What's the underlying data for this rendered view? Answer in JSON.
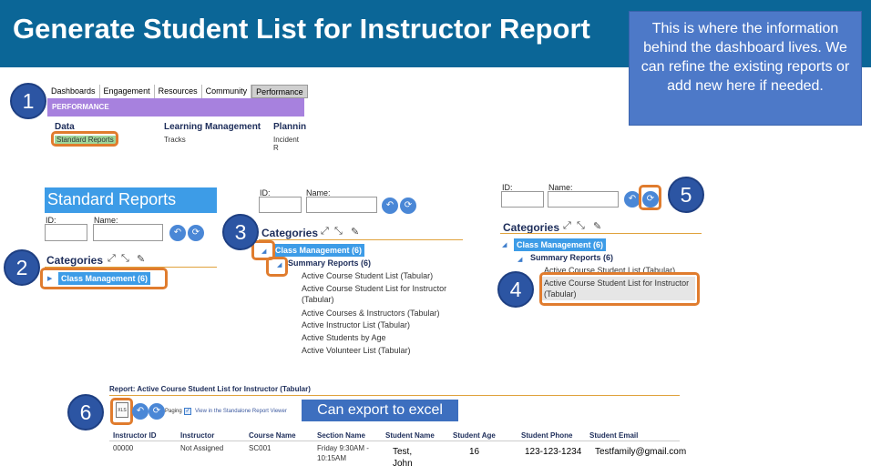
{
  "header": {
    "title": "Generate Student List for Instructor Report",
    "note": "This is where the information behind the dashboard lives. We can refine the existing reports or add new here if needed."
  },
  "steps": [
    "1",
    "2",
    "3",
    "4",
    "5",
    "6"
  ],
  "panel1": {
    "tabs": [
      "Dashboards",
      "Engagement",
      "Resources",
      "Community",
      "Performance"
    ],
    "bar": "PERFORMANCE",
    "columns": [
      {
        "heading": "Data",
        "item": "Standard Reports"
      },
      {
        "heading": "Learning Management",
        "item": "Tracks"
      },
      {
        "heading": "Plannin",
        "item": "Incident R"
      }
    ]
  },
  "search": {
    "id_label": "ID:",
    "name_label": "Name:"
  },
  "categories": {
    "heading": "Categories",
    "selected": "Class Management (6)",
    "sub": "Summary Reports (6)"
  },
  "panel2": {
    "title": "Standard Reports"
  },
  "panel3": {
    "reports": [
      "Active Course Student List (Tabular)",
      "Active Course Student List for Instructor",
      "(Tabular)",
      "Active Courses & Instructors (Tabular)",
      "Active Instructor List (Tabular)",
      "Active Students by Age",
      "Active Volunteer List (Tabular)"
    ]
  },
  "panel4": {
    "report1": "Active Course Student List (Tabular)",
    "report2a": "Active Course Student List for Instructor",
    "report2b": "(Tabular)"
  },
  "panel6": {
    "title": "Report: Active Course Student List for Instructor (Tabular)",
    "xls": "XLS",
    "paging": "Paging",
    "viewer": "View in the Standalone Report Viewer",
    "export_note": "Can export to excel",
    "columns": [
      "Instructor ID",
      "Instructor",
      "Course Name",
      "Section Name",
      "Student Name",
      "Student Age",
      "Student Phone",
      "Student Email"
    ],
    "row": {
      "instructor_id": "00000",
      "instructor": "Not Assigned",
      "course": "SC001",
      "section1": "Friday 9:30AM -",
      "section2": "10:15AM",
      "student1": "Test,",
      "student2": "John",
      "age": "16",
      "phone": "123-123-1234",
      "email": "Testfamily@gmail.com"
    }
  }
}
